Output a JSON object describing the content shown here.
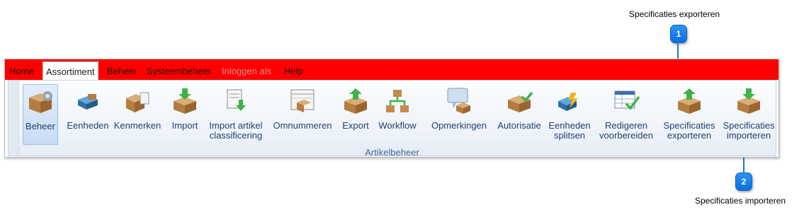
{
  "callouts": [
    {
      "number": "1",
      "label": "Specificaties exporteren"
    },
    {
      "number": "2",
      "label": "Specificaties importeren"
    }
  ],
  "menu": {
    "items": [
      {
        "label": "Home"
      },
      {
        "label": "Assortiment"
      },
      {
        "label": "Beheer"
      },
      {
        "label": "Systeembeheer"
      },
      {
        "label": "Inloggen als"
      },
      {
        "label": "Help"
      }
    ],
    "active": "Assortiment"
  },
  "ribbon": {
    "group_label": "Artikelbeheer",
    "buttons": [
      {
        "label": "Beheer",
        "icon": "box-gear-icon",
        "selected": true
      },
      {
        "label": "Eenheden",
        "icon": "floppy-disk-icon"
      },
      {
        "label": "Kenmerken",
        "icon": "box-document-icon"
      },
      {
        "label": "Import",
        "icon": "box-import-arrow-icon"
      },
      {
        "label": "Import artikel\nclassificering",
        "icon": "document-import-icon"
      },
      {
        "label": "Omnummeren",
        "icon": "table-box-icon"
      },
      {
        "label": "Export",
        "icon": "box-export-arrow-icon"
      },
      {
        "label": "Workflow",
        "icon": "workflow-boxes-icon"
      },
      {
        "label": "Opmerkingen",
        "icon": "speech-bubble-box-icon"
      },
      {
        "label": "Autorisatie",
        "icon": "box-checkmark-icon"
      },
      {
        "label": "Eenheden\nsplitsen",
        "icon": "floppy-lightning-icon"
      },
      {
        "label": "Redigeren\nvoorbereiden",
        "icon": "table-checkmark-icon"
      },
      {
        "label": "Specificaties\nexporteren",
        "icon": "box-export-arrow-icon"
      },
      {
        "label": "Specificaties\nimporteren",
        "icon": "box-import-arrow-icon"
      }
    ]
  },
  "colors": {
    "menubar": "#ff0000",
    "badge": "#1b7ad6",
    "label": "#1f3f6e"
  }
}
